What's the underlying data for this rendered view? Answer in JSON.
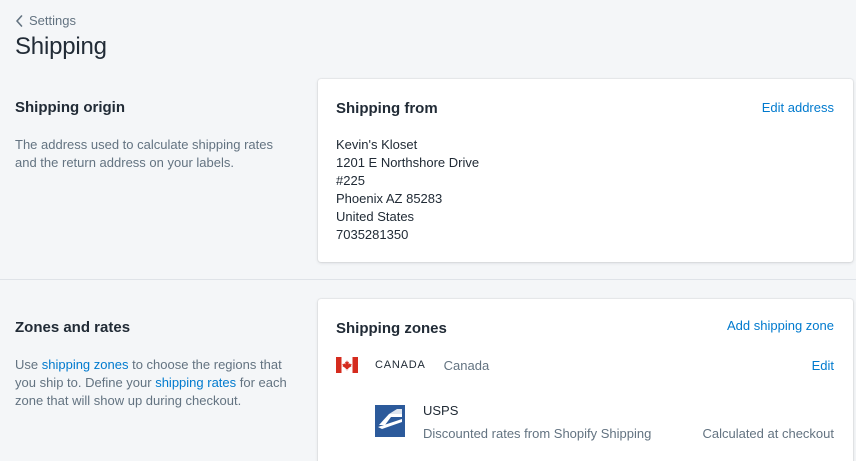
{
  "breadcrumb": {
    "label": "Settings"
  },
  "page": {
    "title": "Shipping"
  },
  "origin_section": {
    "title": "Shipping origin",
    "description": "The address used to calculate shipping rates and the return address on your labels."
  },
  "shipping_from_card": {
    "title": "Shipping from",
    "action_label": "Edit address",
    "address_lines": [
      "Kevin's Kloset",
      "1201 E Northshore Drive",
      "#225",
      "Phoenix AZ 85283",
      "United States",
      "7035281350"
    ]
  },
  "zones_section": {
    "title": "Zones and rates",
    "desc_part1": "Use ",
    "desc_link1": "shipping zones",
    "desc_part2": " to choose the regions that you ship to. Define your ",
    "desc_link2": "shipping rates",
    "desc_part3": " for each zone that will show up during checkout."
  },
  "zones_card": {
    "title": "Shipping zones",
    "action_label": "Add shipping zone",
    "zones": [
      {
        "code": "CANADA",
        "name": "Canada",
        "edit_label": "Edit",
        "flag_icon": "canada-flag-icon",
        "carrier": {
          "name": "USPS",
          "description": "Discounted rates from Shopify Shipping",
          "rate": "Calculated at checkout",
          "logo_icon": "usps-logo-icon"
        }
      }
    ]
  },
  "colors": {
    "link": "#007ace",
    "background": "#f4f6f8",
    "text": "#212b36",
    "muted": "#637381",
    "flag_red": "#d52b1e",
    "usps_blue": "#2c5a9b"
  }
}
